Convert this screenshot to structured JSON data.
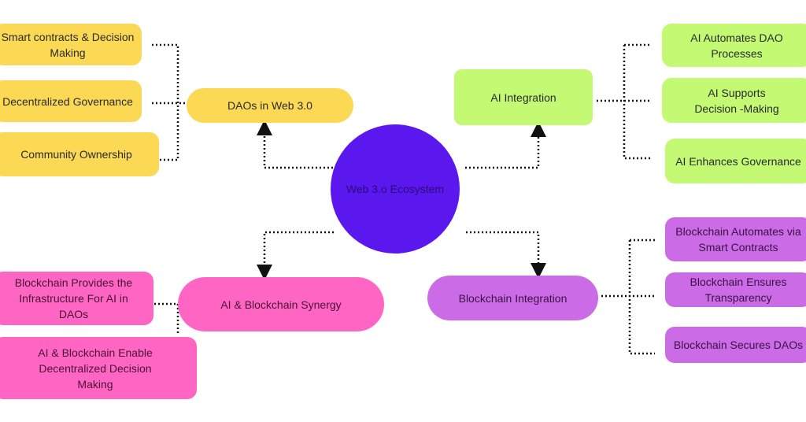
{
  "center": {
    "label": "Web 3.o Ecosystem"
  },
  "colors": {
    "yellow": "#fbd955",
    "green": "#c3f973",
    "pink": "#ff66c4",
    "purple": "#cb6ce6",
    "center": "#5a18ee"
  },
  "branches": {
    "daos": {
      "label": "DAOs in Web 3.0",
      "children": [
        "Smart contracts & Decision Making",
        "Decentralized Governance",
        "Community Ownership"
      ]
    },
    "ai": {
      "label": "AI Integration",
      "children": [
        "AI Automates DAO Processes",
        "AI Supports Decision -Making",
        "AI Enhances Governance"
      ]
    },
    "synergy": {
      "label": "AI & Blockchain Synergy",
      "children": [
        "Blockchain Provides the Infrastructure For AI in DAOs",
        "AI & Blockchain Enable Decentralized Decision Making"
      ]
    },
    "blockchain": {
      "label": "Blockchain Integration",
      "children": [
        "Blockchain Automates via Smart Contracts",
        "Blockchain Ensures Transparency",
        "Blockchain Secures DAOs"
      ]
    }
  }
}
